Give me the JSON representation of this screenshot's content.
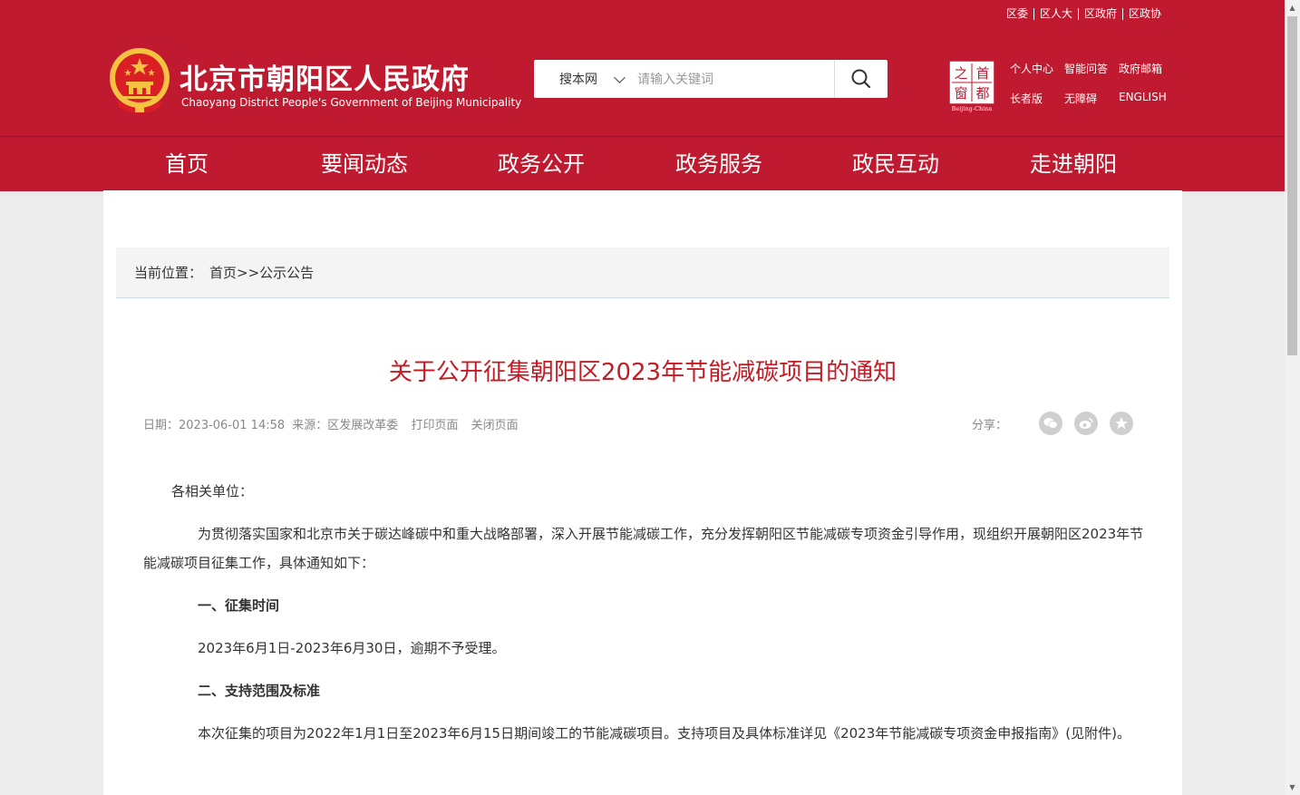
{
  "top_links": [
    "区委",
    "区人大",
    "区政府",
    "区政协"
  ],
  "site": {
    "title": "北京市朝阳区人民政府",
    "subtitle": "Chaoyang District People's Government of Beijing Municipality"
  },
  "search": {
    "scope": "搜本网",
    "placeholder": "请输入关键词"
  },
  "seal": {
    "chars": [
      "首",
      "之",
      "都",
      "窗"
    ],
    "caption": "Beijing-China"
  },
  "right_links": {
    "row1": [
      "个人中心",
      "智能问答",
      "政府邮箱"
    ],
    "row2": [
      "长者版",
      "无障碍",
      "ENGLISH"
    ]
  },
  "nav": [
    "首页",
    "要闻动态",
    "政务公开",
    "政务服务",
    "政民互动",
    "走进朝阳"
  ],
  "nav_active": "要闻动态",
  "breadcrumb": {
    "label": "当前位置：",
    "home": "首页",
    "sep": ">>",
    "current": "公示公告"
  },
  "article": {
    "title": "关于公开征集朝阳区2023年节能减碳项目的通知",
    "date": "日期：2023-06-01 14:58",
    "source": "来源：区发展改革委",
    "print": "打印页面",
    "close": "关闭页面",
    "share_label": "分享：",
    "salutation": "各相关单位：",
    "para1": "为贯彻落实国家和北京市关于碳达峰碳中和重大战略部署，深入开展节能减碳工作，充分发挥朝阳区节能减碳专项资金引导作用，现组织开展朝阳区2023年节能减碳项目征集工作，具体通知如下：",
    "h1": "一、征集时间",
    "para2": "2023年6月1日-2023年6月30日，逾期不予受理。",
    "h2": "二、支持范围及标准",
    "para3": "本次征集的项目为2022年1月1日至2023年6月15日期间竣工的节能减碳项目。支持项目及具体标准详见《2023年节能减碳专项资金申报指南》(见附件)。"
  },
  "colors": {
    "brand_red": "#bf1a2f",
    "title_red": "#c41c25",
    "nav_active_underline": "#e8a33a"
  }
}
